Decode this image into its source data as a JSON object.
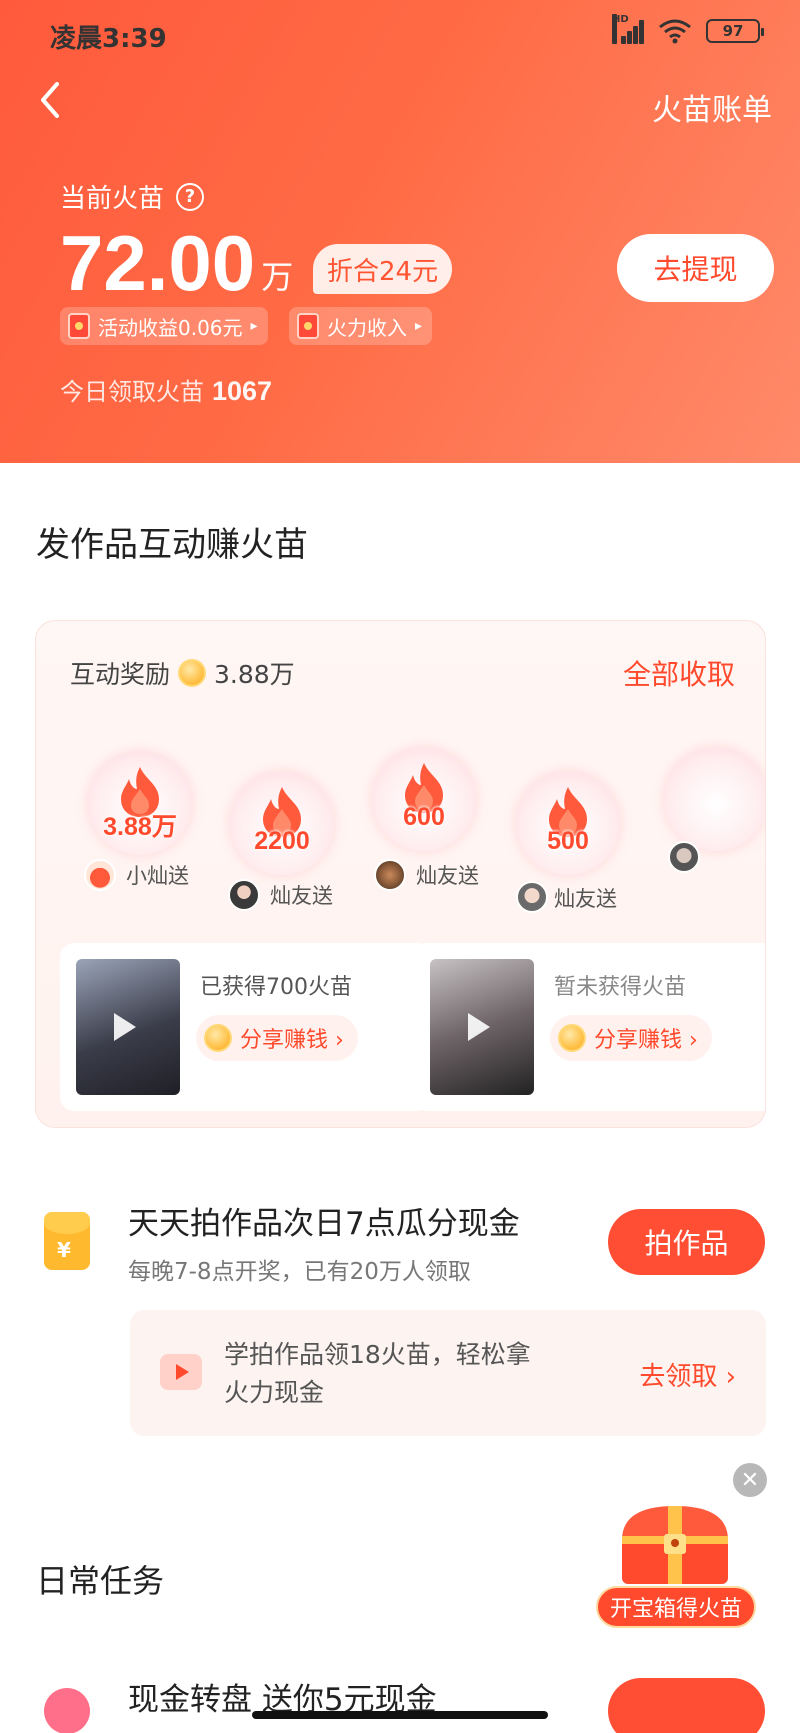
{
  "status_bar": {
    "time": "凌晨3:39",
    "signal_label": "HD",
    "battery": "97"
  },
  "header": {
    "bill_link": "火苗账单",
    "balance_label": "当前火苗",
    "help_glyph": "?",
    "balance": "72.00",
    "balance_unit": "万",
    "equivalent": "折合24元",
    "withdraw_button": "去提现",
    "chips": [
      {
        "label": "活动收益0.06元",
        "icon": "red-envelope-icon"
      },
      {
        "label": "火力收入",
        "icon": "fire-power-icon"
      }
    ],
    "chip_arrow": "▸",
    "today_label": "今日领取火苗",
    "today_value": "1067"
  },
  "section_title": "发作品互动赚火苗",
  "interaction": {
    "reward_label": "互动奖励",
    "reward_value": "3.88万",
    "collect_all": "全部收取",
    "bubbles": [
      {
        "amount": "3.88万",
        "sender": "小灿送"
      },
      {
        "amount": "2200",
        "sender": "灿友送"
      },
      {
        "amount": "600",
        "sender": "灿友送"
      },
      {
        "amount": "500",
        "sender": "灿友送"
      }
    ],
    "works": [
      {
        "status": "已获得700火苗",
        "share_label": "分享赚钱 ›"
      },
      {
        "status": "暂未获得火苗",
        "share_label": "分享赚钱 ›"
      }
    ]
  },
  "task": {
    "icon_glyph": "¥",
    "title": "天天拍作品次日7点瓜分现金",
    "subtitle": "每晚7-8点开奖，已有20万人领取",
    "button": "拍作品",
    "promo_text": "学拍作品领18火苗，轻松拿火力现金",
    "promo_link": "去领取 ›"
  },
  "daily": {
    "title": "日常任务",
    "treasure_label": "开宝箱得火苗",
    "close_glyph": "✕",
    "partial_task": "现金转盘 送你5元现金"
  },
  "colors": {
    "accent": "#ff4a2d",
    "header_start": "#ff5a3c",
    "header_end": "#ff8a6a"
  }
}
